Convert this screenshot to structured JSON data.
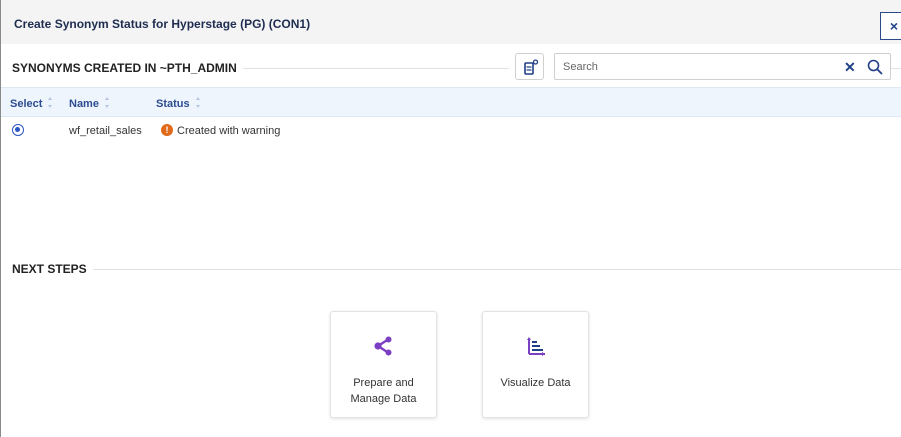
{
  "dialog": {
    "title": "Create Synonym Status for Hyperstage (PG) (CON1)",
    "close_label": "×"
  },
  "synonyms_section": {
    "heading": "SYNONYMS CREATED IN ~PTH_ADMIN"
  },
  "search": {
    "placeholder": "Search",
    "value": ""
  },
  "table": {
    "columns": [
      "Select",
      "Name",
      "Status"
    ],
    "rows": [
      {
        "selected": true,
        "name": "wf_retail_sales",
        "status": "Created with warning"
      }
    ]
  },
  "next_steps": {
    "heading": "NEXT STEPS",
    "cards": [
      {
        "label_line1": "Prepare and",
        "label_line2": "Manage Data",
        "icon": "share-graph-icon"
      },
      {
        "label": "Visualize Data",
        "icon": "bar-chart-icon"
      }
    ]
  },
  "colors": {
    "brand_blue": "#1f3f86",
    "header_text": "#2d4d91",
    "radio": "#2a54c4",
    "warning": "#e06a1a",
    "icon_purple": "#7b3fc4"
  }
}
